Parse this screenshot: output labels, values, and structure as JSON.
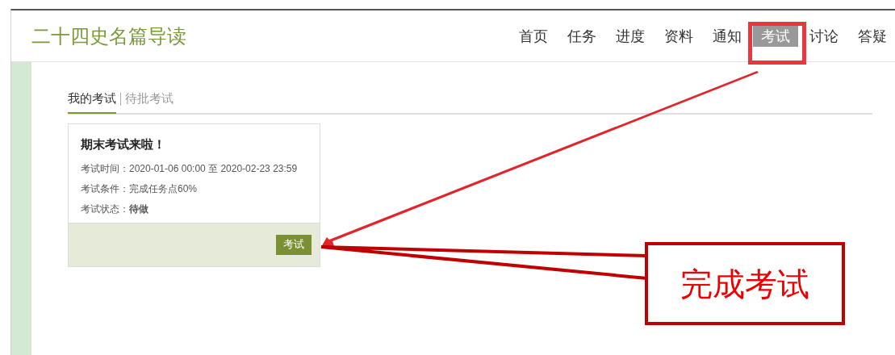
{
  "app_title": "二十四史名篇导读",
  "nav": [
    {
      "label": "首页",
      "selected": false
    },
    {
      "label": "任务",
      "selected": false
    },
    {
      "label": "进度",
      "selected": false
    },
    {
      "label": "资料",
      "selected": false
    },
    {
      "label": "通知",
      "selected": false
    },
    {
      "label": "考试",
      "selected": true
    },
    {
      "label": "讨论",
      "selected": false
    },
    {
      "label": "答疑",
      "selected": false
    }
  ],
  "tabs": [
    {
      "label": "我的考试",
      "selected": true
    },
    {
      "label": "待批考试",
      "selected": false
    }
  ],
  "exam_card": {
    "title": "期末考试来啦！",
    "details": [
      "考试时间：2020-01-06 00:00 至 2020-02-23 23:59",
      "考试条件：完成任务点60%",
      "考试状态：**待做**"
    ],
    "button": "考试"
  },
  "annotation": {
    "callout": "完成考试"
  }
}
